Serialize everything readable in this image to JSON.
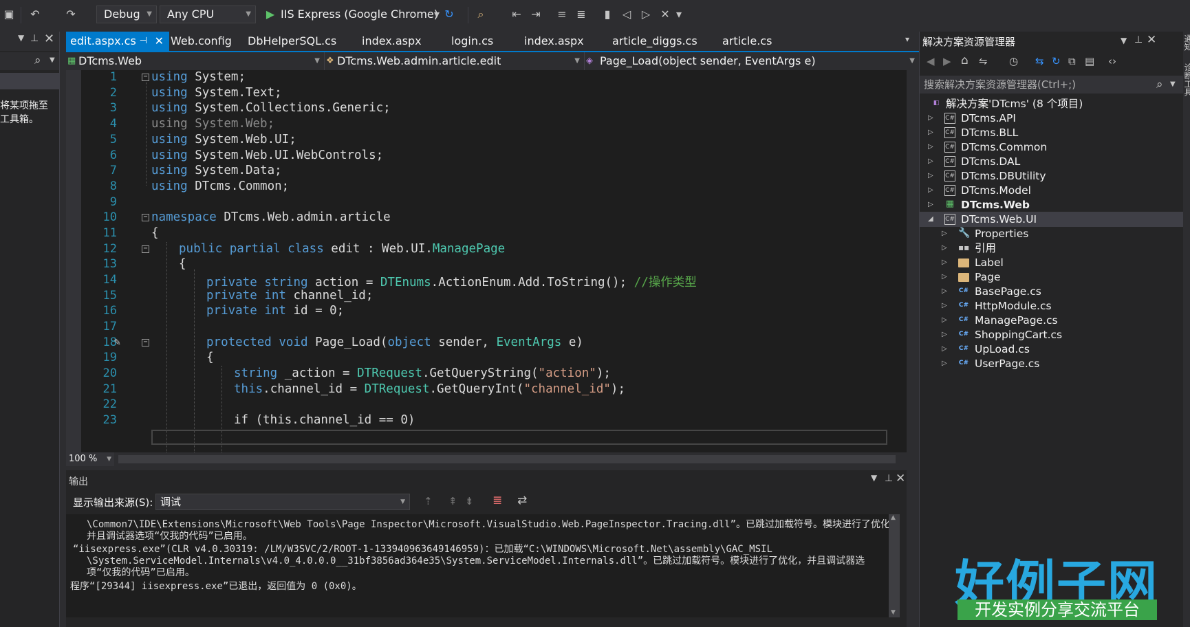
{
  "toolbar": {
    "config": "Debug",
    "platform": "Any CPU",
    "run_target": "IIS Express (Google Chrome)"
  },
  "left_panel": {
    "message_line1": "将某项拖至",
    "message_line2": "工具箱。"
  },
  "tabs": [
    {
      "label": "edit.aspx.cs",
      "active": true
    },
    {
      "label": "Web.config"
    },
    {
      "label": "DbHelperSQL.cs"
    },
    {
      "label": "index.aspx"
    },
    {
      "label": "login.cs"
    },
    {
      "label": "index.aspx"
    },
    {
      "label": "article_diggs.cs"
    },
    {
      "label": "article.cs"
    }
  ],
  "navbar": {
    "project": "DTcms.Web",
    "class": "DTcms.Web.admin.article.edit",
    "member": "Page_Load(object sender, EventArgs e)"
  },
  "editor": {
    "zoom": "100 %",
    "line_numbers": [
      "1",
      "2",
      "3",
      "4",
      "5",
      "6",
      "7",
      "8",
      "9",
      "10",
      "11",
      "12",
      "13",
      "14",
      "15",
      "16",
      "17",
      "18",
      "19",
      "20",
      "21",
      "22",
      "23"
    ],
    "lines": {
      "l1": "System;",
      "l2": "System.Text;",
      "l3": "System.Collections.Generic;",
      "l4": "System.Web;",
      "l5": "System.Web.UI;",
      "l6": "System.Web.UI.WebControls;",
      "l7": "System.Data;",
      "l8": "DTcms.Common;",
      "l10": " DTcms.Web.admin.article",
      "l11": "{",
      "l12_name": " edit : Web.UI.",
      "l12_base": "ManagePage",
      "l13": "{",
      "l14_mid": " action = ",
      "l14_type": "DTEnums",
      "l14_rest": ".ActionEnum.Add.ToString(); ",
      "l14_comment": "//操作类型",
      "l15": " channel_id;",
      "l16": " id = 0;",
      "l18_name": " Page_Load(",
      "l18_p1": " sender, ",
      "l18_t2": "EventArgs",
      "l18_end": " e)",
      "l19": "{",
      "l20_mid": " _action = ",
      "l20_type": "DTRequest",
      "l20_call": ".GetQueryString(",
      "l20_str": "\"action\"",
      "l20_end": ");",
      "l21_mid": ".channel_id = ",
      "l21_type": "DTRequest",
      "l21_call": ".GetQueryInt(",
      "l21_str": "\"channel_id\"",
      "l21_end": ");",
      "l23": "if (this.channel_id == 0)"
    },
    "keywords": {
      "using": "using",
      "namespace": "namespace",
      "public": "public",
      "partial": "partial",
      "class": "class",
      "private": "private",
      "string": "string",
      "int": "int",
      "protected": "protected",
      "void": "void",
      "object": "object",
      "this": "this"
    }
  },
  "output": {
    "title": "输出",
    "source_label": "显示输出来源(S):",
    "source_value": "调试",
    "lines": [
      "\\Common7\\IDE\\Extensions\\Microsoft\\Web Tools\\Page Inspector\\Microsoft.VisualStudio.Web.PageInspector.Tracing.dll”。已跳过加载符号。模块进行了优化，",
      "并且调试器选项“仅我的代码”已启用。",
      "“iisexpress.exe”(CLR v4.0.30319: /LM/W3SVC/2/ROOT-1-133940963649146959)：已加载“C:\\WINDOWS\\Microsoft.Net\\assembly\\GAC_MSIL",
      "\\System.ServiceModel.Internals\\v4.0_4.0.0.0__31bf3856ad364e35\\System.ServiceModel.Internals.dll”。已跳过加载符号。模块进行了优化，并且调试器选",
      "项“仅我的代码”已启用。",
      "程序“[29344] iisexpress.exe”已退出，返回值为 0 (0x0)。"
    ]
  },
  "solution_explorer": {
    "title": "解决方案资源管理器",
    "search_placeholder": "搜索解决方案资源管理器(Ctrl+;)",
    "root": "解决方案'DTcms' (8 个项目)",
    "projects": [
      "DTcms.API",
      "DTcms.BLL",
      "DTcms.Common",
      "DTcms.DAL",
      "DTcms.DBUtility",
      "DTcms.Model",
      "DTcms.Web",
      "DTcms.Web.UI"
    ],
    "children": [
      "Properties",
      "引用",
      "Label",
      "Page",
      "BasePage.cs",
      "HttpModule.cs",
      "ManagePage.cs",
      "ShoppingCart.cs",
      "UpLoad.cs",
      "UserPage.cs"
    ]
  },
  "right_strip": {
    "tab1": "通知",
    "tab2": "诊断工具"
  },
  "logo": {
    "main": "好例子网",
    "sub": "开发实例分享交流平台"
  },
  "colors": {
    "accent": "#007acc",
    "keyword": "#569cd6",
    "type": "#4ec9b0",
    "string": "#d69d85",
    "comment": "#57a64a",
    "line_number": "#2b91af"
  }
}
